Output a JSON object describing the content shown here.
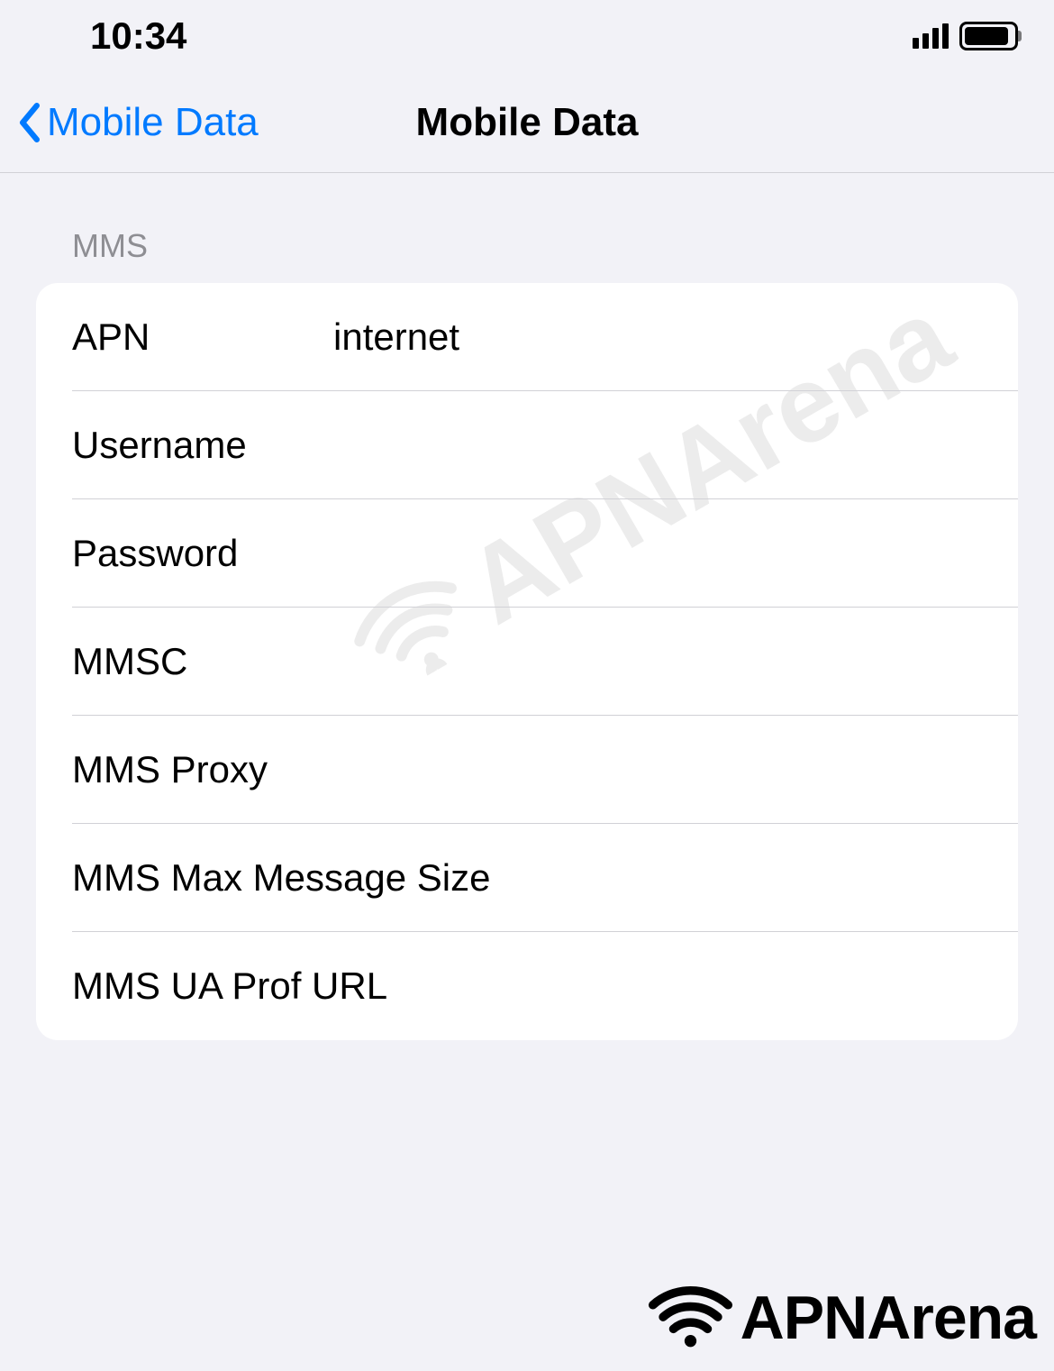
{
  "statusBar": {
    "time": "10:34"
  },
  "navBar": {
    "backLabel": "Mobile Data",
    "title": "Mobile Data"
  },
  "section": {
    "header": "MMS",
    "rows": {
      "apn": {
        "label": "APN",
        "value": "internet"
      },
      "username": {
        "label": "Username",
        "value": ""
      },
      "password": {
        "label": "Password",
        "value": ""
      },
      "mmsc": {
        "label": "MMSC",
        "value": ""
      },
      "mmsProxy": {
        "label": "MMS Proxy",
        "value": ""
      },
      "mmsMaxSize": {
        "label": "MMS Max Message Size",
        "value": ""
      },
      "mmsUaProf": {
        "label": "MMS UA Prof URL",
        "value": ""
      }
    }
  },
  "watermark": {
    "text": "APNArena"
  },
  "footer": {
    "text": "APNArena"
  }
}
